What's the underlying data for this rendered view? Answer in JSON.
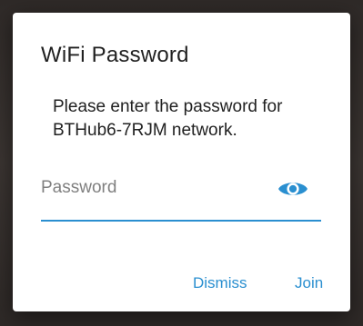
{
  "dialog": {
    "title": "WiFi Password",
    "message_line1": "Please enter the password for",
    "message_line2": "BTHub6-7RJM network.",
    "password_field": {
      "placeholder": "Password",
      "value": "",
      "visibility_icon": "eye-icon"
    },
    "actions": {
      "dismiss_label": "Dismiss",
      "join_label": "Join"
    }
  },
  "colors": {
    "accent": "#2a8fd0",
    "title_text": "#212121",
    "placeholder_text": "#808080",
    "dialog_bg": "#ffffff",
    "backdrop": "#3a3431"
  }
}
